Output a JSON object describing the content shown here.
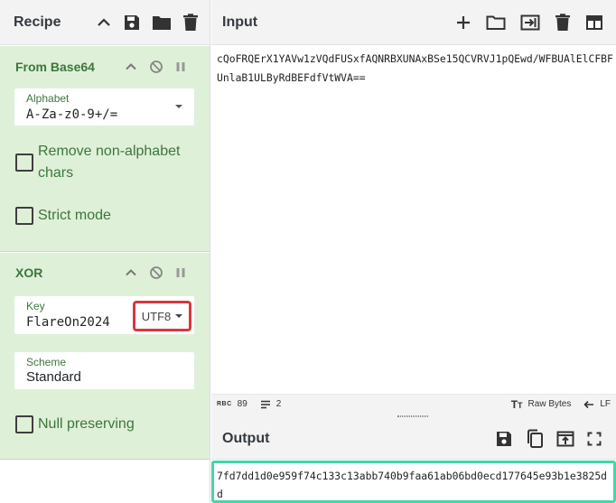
{
  "recipe": {
    "title": "Recipe",
    "operations": [
      {
        "name": "From Base64",
        "alphabet_label": "Alphabet",
        "alphabet_value": "A-Za-z0-9+/=",
        "remove_non_alphabet_label": "Remove non-alphabet chars",
        "remove_non_alphabet_checked": false,
        "strict_mode_label": "Strict mode",
        "strict_mode_checked": false
      },
      {
        "name": "XOR",
        "key_label": "Key",
        "key_value": "FlareOn2024",
        "key_type": "UTF8",
        "scheme_label": "Scheme",
        "scheme_value": "Standard",
        "null_preserving_label": "Null preserving",
        "null_preserving_checked": false
      }
    ]
  },
  "input": {
    "title": "Input",
    "text": "cQoFRQErX1YAVw1zVQdFUSxfAQNRBXUNAxBSe15QCVRVJ1pQEwd/WFBUAlElCFBFUnlaB1ULByRdBEFdfVtWVA==",
    "status": {
      "char_count_label": "RBC",
      "char_count": "89",
      "line_count": "2",
      "encoding": "Raw Bytes",
      "eol": "LF"
    }
  },
  "output": {
    "title": "Output",
    "text": "7fd7dd1d0e959f74c133c13abb740b9faa61ab06bd0ecd177645e93b1e3825dd"
  },
  "colors": {
    "operation_bg": "#dff0d8",
    "operation_text": "#3c763d",
    "highlight_red": "#d9363e",
    "highlight_green": "#3fd8a7"
  }
}
